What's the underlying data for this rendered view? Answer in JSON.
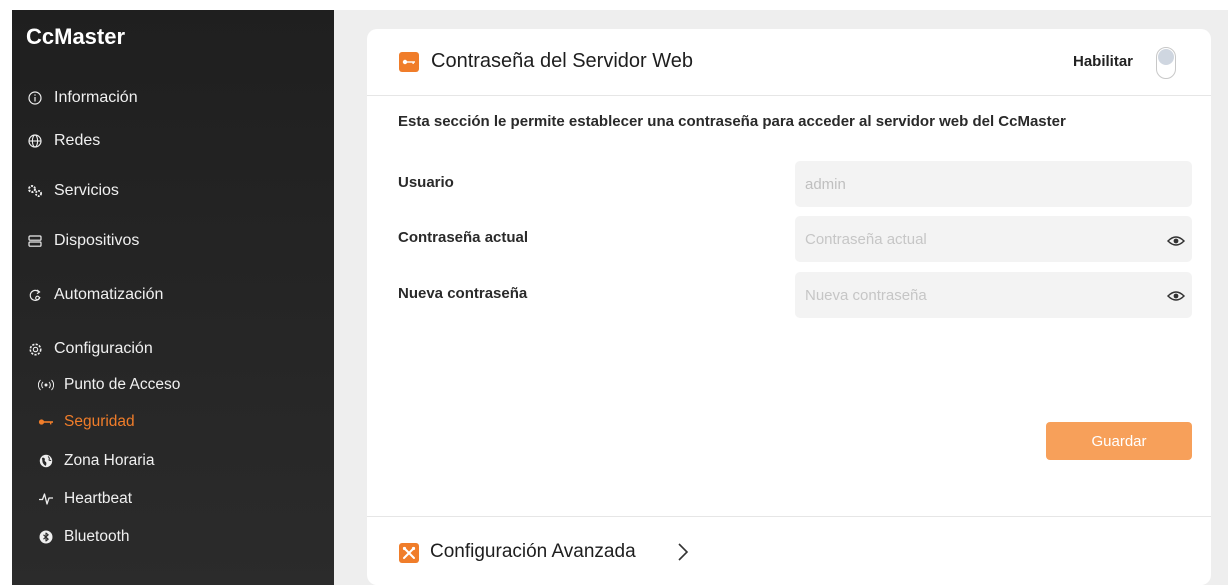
{
  "app": {
    "name": "CcMaster"
  },
  "sidebar": {
    "items": [
      {
        "label": "Información",
        "icon": "info-icon"
      },
      {
        "label": "Redes",
        "icon": "globe-icon"
      },
      {
        "label": "Servicios",
        "icon": "cogs-icon"
      },
      {
        "label": "Dispositivos",
        "icon": "devices-icon"
      },
      {
        "label": "Automatización",
        "icon": "automation-icon"
      },
      {
        "label": "Configuración",
        "icon": "gear-icon"
      }
    ],
    "sub_items": [
      {
        "label": "Punto de Acceso",
        "icon": "access-point-icon"
      },
      {
        "label": "Seguridad",
        "icon": "key-icon",
        "active": true
      },
      {
        "label": "Zona Horaria",
        "icon": "globe-filled-icon"
      },
      {
        "label": "Heartbeat",
        "icon": "heartbeat-icon"
      },
      {
        "label": "Bluetooth",
        "icon": "bluetooth-icon"
      }
    ]
  },
  "card": {
    "title": "Contraseña del Servidor Web",
    "toggle_label": "Habilitar",
    "toggle_on": false,
    "description": "Esta sección le permite establecer una contraseña para acceder al servidor web del CcMaster",
    "fields": {
      "user_label": "Usuario",
      "user_value": "admin",
      "current_label": "Contraseña actual",
      "current_placeholder": "Contraseña actual",
      "new_label": "Nueva contraseña",
      "new_placeholder": "Nueva contraseña"
    },
    "save_label": "Guardar"
  },
  "advanced": {
    "title": "Configuración Avanzada"
  },
  "colors": {
    "accent": "#f07d2a",
    "sidebar_bg": "#222222",
    "button": "#f7a05a"
  }
}
